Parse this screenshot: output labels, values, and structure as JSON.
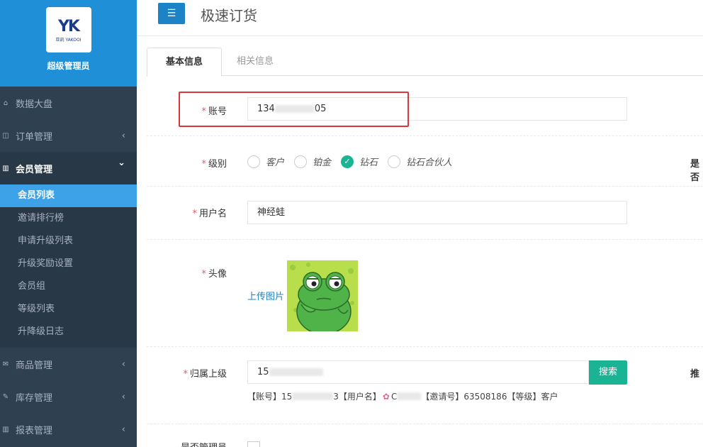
{
  "sidebar": {
    "brand": {
      "logo_mark": "YK",
      "logo_sub": "亚凯 YAKOOI",
      "title": "超级管理员"
    },
    "items": [
      {
        "label": "数据大盘",
        "icon": "home-icon",
        "has_arrow": false
      },
      {
        "label": "订单管理",
        "icon": "columns-icon",
        "has_arrow": true,
        "arrow": "‹"
      },
      {
        "label": "会员管理",
        "icon": "bar-chart-icon",
        "has_arrow": true,
        "arrow": "⌄",
        "expanded": true,
        "children": [
          {
            "label": "会员列表",
            "active": true
          },
          {
            "label": "邀请排行榜"
          },
          {
            "label": "申请升级列表"
          },
          {
            "label": "升级奖励设置"
          },
          {
            "label": "会员组"
          },
          {
            "label": "等级列表"
          },
          {
            "label": "升降级日志"
          }
        ]
      },
      {
        "label": "商品管理",
        "icon": "envelope-icon",
        "has_arrow": true,
        "arrow": "‹"
      },
      {
        "label": "库存管理",
        "icon": "edit-icon",
        "has_arrow": true,
        "arrow": "‹"
      },
      {
        "label": "报表管理",
        "icon": "bar-chart-icon",
        "has_arrow": true,
        "arrow": "‹"
      }
    ]
  },
  "header": {
    "menu_icon": "☰",
    "title": "极速订货"
  },
  "tabs": [
    {
      "label": "基本信息",
      "active": true
    },
    {
      "label": "相关信息",
      "active": false
    }
  ],
  "form": {
    "account": {
      "label": "账号",
      "value_prefix": "134",
      "value_suffix": "05"
    },
    "level": {
      "label": "级别",
      "options": [
        {
          "label": "客户",
          "checked": false
        },
        {
          "label": "铂金",
          "checked": false
        },
        {
          "label": "钻石",
          "checked": true
        },
        {
          "label": "钻石合伙人",
          "checked": false
        }
      ],
      "right_cut_label": "是否"
    },
    "username": {
      "label": "用户名",
      "value": "神经蛙"
    },
    "avatar": {
      "label": "头像",
      "upload_link": "上传图片"
    },
    "parent": {
      "label": "归属上级",
      "value_prefix": "15",
      "search_button": "搜索",
      "right_cut_label": "推",
      "info": {
        "p1": "【账号】15",
        "p2": "3【用户名】",
        "p3": "C",
        "p4": "【邀请号】63508186【等级】客户"
      }
    },
    "admin": {
      "label": "是否管理员"
    }
  },
  "colors": {
    "sidebar_bg": "#2f4050",
    "brand_bg": "#1f8fd8",
    "active_sub": "#3ea2e8",
    "primary": "#1c84c6",
    "success": "#1ab394",
    "required": "#ed5565",
    "highlight_box": "#d9363e"
  }
}
